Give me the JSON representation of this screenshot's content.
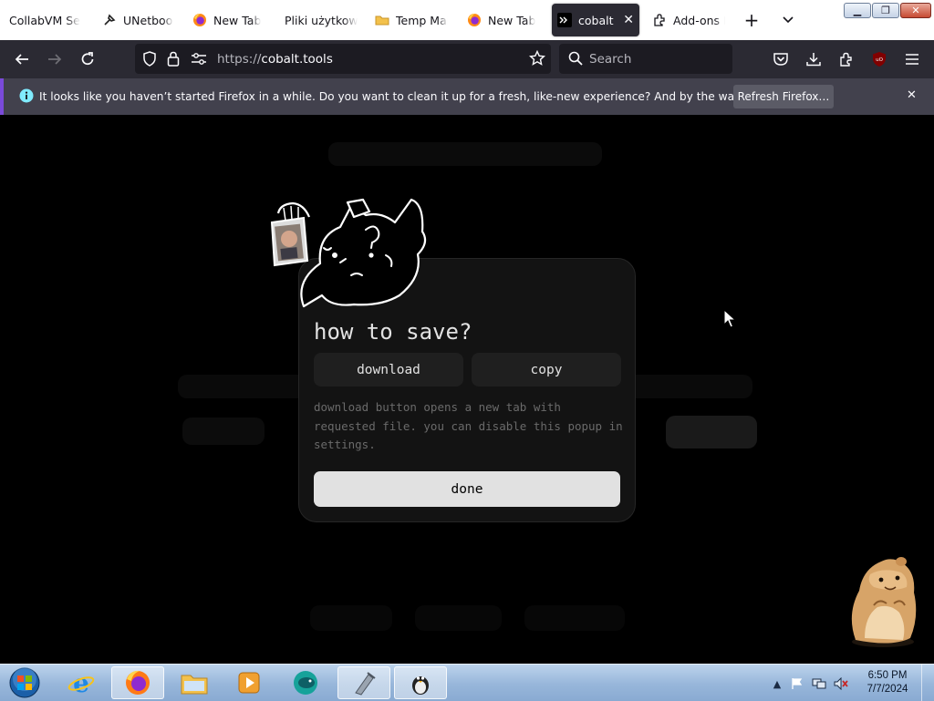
{
  "window": {
    "minimize_glyph": "▁",
    "restore_glyph": "❐",
    "close_glyph": "✕"
  },
  "tabs": [
    {
      "label": "CollabVM Search",
      "icon": "none"
    },
    {
      "label": "UNetbootin",
      "icon": "tool-icon"
    },
    {
      "label": "New Tab",
      "icon": "firefox-icon"
    },
    {
      "label": "Pliki użytkownika",
      "icon": "none"
    },
    {
      "label": "Temp Mail",
      "icon": "folder-icon"
    },
    {
      "label": "New Tab",
      "icon": "firefox-icon"
    },
    {
      "label": "cobalt",
      "icon": "terminal-icon",
      "active": true
    },
    {
      "label": "Add-ons Manager",
      "icon": "puzzle-icon"
    }
  ],
  "tab_actions": {
    "new_tab": "+",
    "list_all": "⌄",
    "close": "✕"
  },
  "urlbar": {
    "scheme": "https://",
    "host": "cobalt.tools"
  },
  "searchbar": {
    "placeholder": "Search"
  },
  "notification": {
    "message": "It looks like you haven’t started Firefox in a while. Do you want to clean it up for a fresh, like-new experience? And by the way, welcome back!",
    "button": "Refresh Firefox…",
    "close": "✕"
  },
  "modal": {
    "title": "how to save?",
    "download_label": "download",
    "copy_label": "copy",
    "description": "download button opens a new tab with requested file. you can disable this popup in settings.",
    "done_label": "done"
  },
  "clock": {
    "time": "6:50 PM",
    "date": "7/7/2024"
  },
  "colors": {
    "accent_tab": "#2b2a33",
    "notification_border": "#7a4ad9",
    "modal_bg": "#131313",
    "done_button": "#e1e1e1"
  }
}
